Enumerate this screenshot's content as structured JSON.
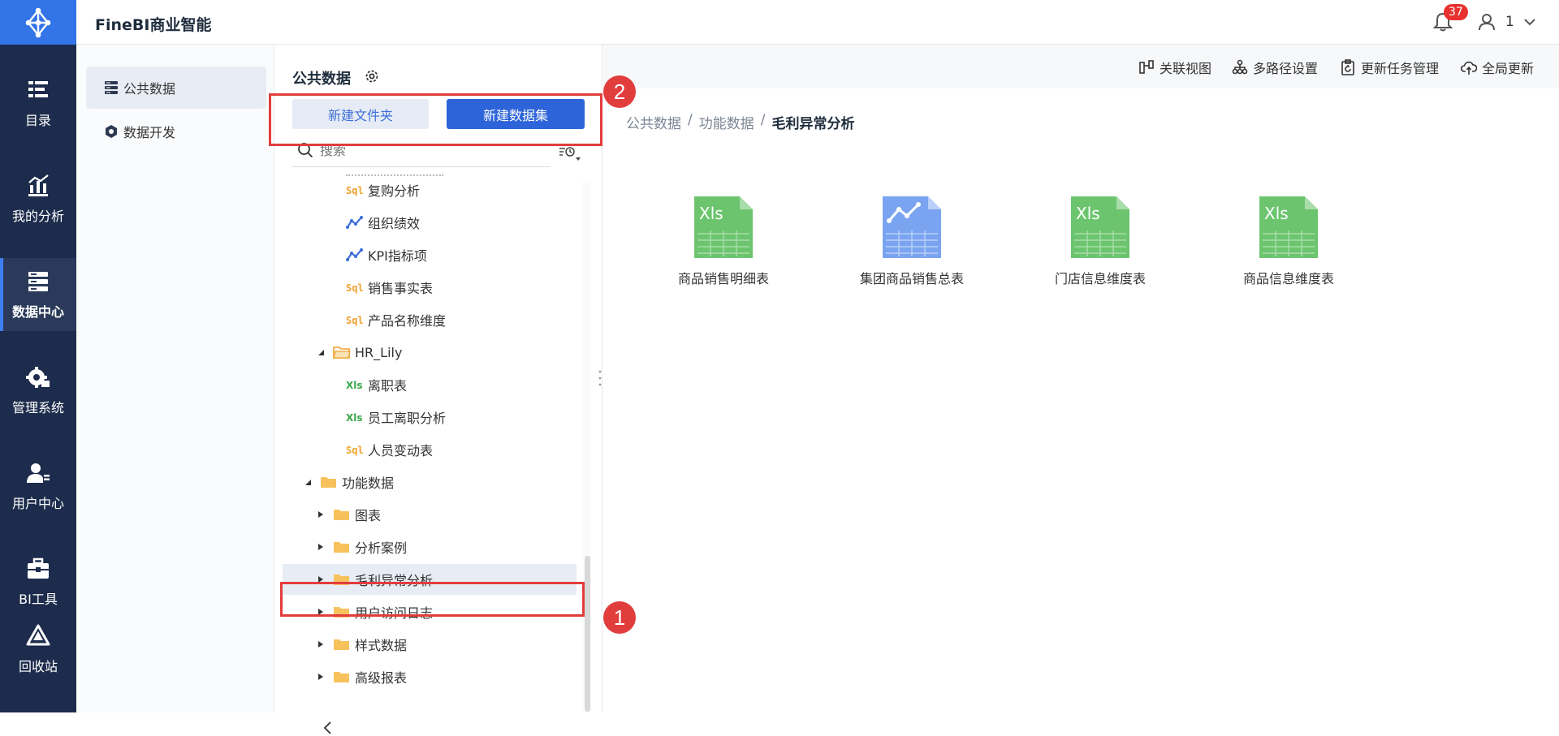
{
  "app": {
    "title": "FineBI商业智能"
  },
  "header": {
    "notification_count": "37",
    "user_name": "1"
  },
  "leftnav": [
    {
      "label": "目录",
      "icon": "catalog-icon"
    },
    {
      "label": "我的分析",
      "icon": "analysis-icon"
    },
    {
      "label": "数据中心",
      "icon": "data-center-icon",
      "active": true
    },
    {
      "label": "管理系统",
      "icon": "settings-icon"
    },
    {
      "label": "用户中心",
      "icon": "user-center-icon"
    },
    {
      "label": "BI工具",
      "icon": "toolbox-icon"
    },
    {
      "label": "回收站",
      "icon": "recycle-icon"
    }
  ],
  "subnav": [
    {
      "label": "公共数据",
      "icon": "public-data-icon",
      "active": true
    },
    {
      "label": "数据开发",
      "icon": "data-dev-icon"
    }
  ],
  "tree": {
    "title": "公共数据",
    "new_folder": "新建文件夹",
    "new_dataset": "新建数据集",
    "search_placeholder": "搜索",
    "items": [
      {
        "label": "复购分析",
        "type": "sql"
      },
      {
        "label": "组织绩效",
        "type": "chart"
      },
      {
        "label": "KPI指标项",
        "type": "chart"
      },
      {
        "label": "销售事实表",
        "type": "sql"
      },
      {
        "label": "产品名称维度",
        "type": "sql"
      },
      {
        "label": "HR_Lily",
        "type": "folder",
        "expanded": true
      },
      {
        "label": "离职表",
        "type": "xls"
      },
      {
        "label": "员工离职分析",
        "type": "xls"
      },
      {
        "label": "人员变动表",
        "type": "sql"
      },
      {
        "label": "功能数据",
        "type": "folder",
        "expanded": true
      },
      {
        "label": "图表",
        "type": "folder"
      },
      {
        "label": "分析案例",
        "type": "folder"
      },
      {
        "label": "毛利异常分析",
        "type": "folder",
        "selected": true
      },
      {
        "label": "用户访问日志",
        "type": "folder"
      },
      {
        "label": "样式数据",
        "type": "folder"
      },
      {
        "label": "高级报表",
        "type": "folder"
      }
    ]
  },
  "toolbar": {
    "relation_view": "关联视图",
    "multi_path": "多路径设置",
    "update_tasks": "更新任务管理",
    "global_update": "全局更新"
  },
  "breadcrumb": [
    "公共数据",
    "功能数据",
    "毛利异常分析"
  ],
  "files": [
    {
      "label": "商品销售明细表",
      "type": "xls"
    },
    {
      "label": "集团商品销售总表",
      "type": "chart"
    },
    {
      "label": "门店信息维度表",
      "type": "xls"
    },
    {
      "label": "商品信息维度表",
      "type": "xls"
    }
  ],
  "annotations": [
    {
      "label": "1"
    },
    {
      "label": "2"
    }
  ],
  "colors": {
    "accent": "#2d64d9",
    "nav_bg": "#1d2c4c",
    "highlight": "#e23d3d",
    "xls_green": "#6cc56e",
    "chart_blue": "#7aa4f0"
  }
}
